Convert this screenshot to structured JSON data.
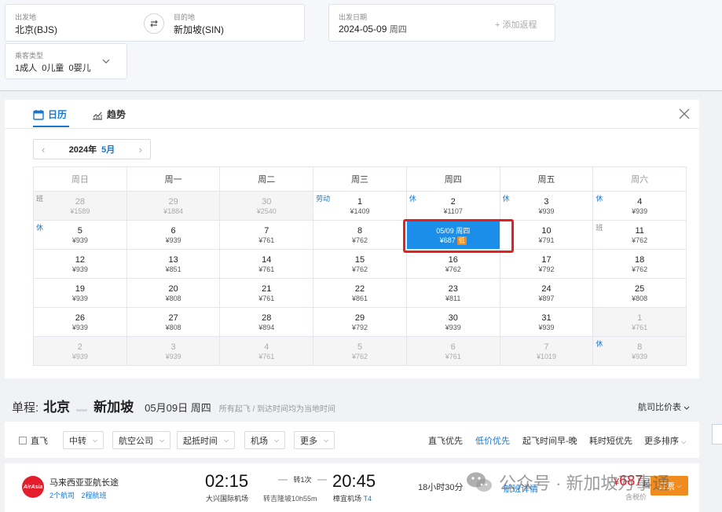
{
  "search": {
    "from": {
      "label": "出发地",
      "value": "北京(BJS)"
    },
    "to": {
      "label": "目的地",
      "value": "新加坡(SIN)"
    },
    "date": {
      "label": "出发日期",
      "value": "2024-05-09",
      "weekday": "周四"
    },
    "add_return": "+ 添加返程",
    "passengers": {
      "label": "乘客类型",
      "value": "1成人  0儿童  0婴儿"
    }
  },
  "calendar": {
    "tabs": [
      {
        "label": "日历"
      },
      {
        "label": "趋势"
      }
    ],
    "year": "2024年",
    "month": "5月",
    "weekdays": [
      "周日",
      "周一",
      "周二",
      "周三",
      "周四",
      "周五",
      "周六"
    ],
    "tag_labels": {
      "xiu": "休",
      "ban": "班",
      "laodong": "劳动"
    },
    "low_label": "低",
    "weeks": [
      [
        {
          "day": "28",
          "price": "¥1589",
          "other": true,
          "tag": "ban"
        },
        {
          "day": "29",
          "price": "¥1884",
          "other": true
        },
        {
          "day": "30",
          "price": "¥2540",
          "other": true
        },
        {
          "day": "1",
          "price": "¥1409",
          "tag": "laodong"
        },
        {
          "day": "2",
          "price": "¥1107",
          "tag": "xiu"
        },
        {
          "day": "3",
          "price": "¥939",
          "tag": "xiu"
        },
        {
          "day": "4",
          "price": "¥939",
          "tag": "xiu"
        }
      ],
      [
        {
          "day": "5",
          "price": "¥939",
          "tag": "xiu"
        },
        {
          "day": "6",
          "price": "¥939"
        },
        {
          "day": "7",
          "price": "¥761"
        },
        {
          "day": "8",
          "price": "¥762"
        },
        {
          "day": "05/09 周四",
          "price": "¥687",
          "selected": true,
          "low": true
        },
        {
          "day": "10",
          "price": "¥791"
        },
        {
          "day": "11",
          "price": "¥762",
          "tag": "ban"
        }
      ],
      [
        {
          "day": "12",
          "price": "¥939"
        },
        {
          "day": "13",
          "price": "¥851"
        },
        {
          "day": "14",
          "price": "¥761"
        },
        {
          "day": "15",
          "price": "¥762"
        },
        {
          "day": "16",
          "price": "¥762"
        },
        {
          "day": "17",
          "price": "¥792"
        },
        {
          "day": "18",
          "price": "¥762"
        }
      ],
      [
        {
          "day": "19",
          "price": "¥939"
        },
        {
          "day": "20",
          "price": "¥808"
        },
        {
          "day": "21",
          "price": "¥761"
        },
        {
          "day": "22",
          "price": "¥861"
        },
        {
          "day": "23",
          "price": "¥811"
        },
        {
          "day": "24",
          "price": "¥897"
        },
        {
          "day": "25",
          "price": "¥808"
        }
      ],
      [
        {
          "day": "26",
          "price": "¥939"
        },
        {
          "day": "27",
          "price": "¥808"
        },
        {
          "day": "28",
          "price": "¥894"
        },
        {
          "day": "29",
          "price": "¥792"
        },
        {
          "day": "30",
          "price": "¥939"
        },
        {
          "day": "31",
          "price": "¥939"
        },
        {
          "day": "1",
          "price": "¥761",
          "other": true
        }
      ],
      [
        {
          "day": "2",
          "price": "¥939",
          "other": true
        },
        {
          "day": "3",
          "price": "¥939",
          "other": true
        },
        {
          "day": "4",
          "price": "¥761",
          "other": true
        },
        {
          "day": "5",
          "price": "¥762",
          "other": true
        },
        {
          "day": "6",
          "price": "¥761",
          "other": true
        },
        {
          "day": "7",
          "price": "¥1019",
          "other": true
        },
        {
          "day": "8",
          "price": "¥939",
          "other": true,
          "tag": "xiu"
        }
      ]
    ]
  },
  "route": {
    "label": "单程:",
    "from": "北京",
    "to": "新加坡",
    "date": "05月09日 周四",
    "note": "所有起飞 / 到达时间均为当地时间",
    "price_table": "航司比价表"
  },
  "filters": {
    "direct": "直飞",
    "dropdowns": [
      "中转",
      "航空公司",
      "起抵时间",
      "机场",
      "更多"
    ],
    "sorts": [
      {
        "label": "直飞优先",
        "active": false
      },
      {
        "label": "低价优先",
        "active": true
      },
      {
        "label": "起飞时间早-晚",
        "active": false
      },
      {
        "label": "耗时短优先",
        "active": false
      },
      {
        "label": "更多排序",
        "active": false
      }
    ]
  },
  "flight": {
    "logo_text": "AirAsia",
    "airline": "马来西亚亚航长途",
    "sub": [
      "2个航司",
      "2程航班"
    ],
    "dep_time": "02:15",
    "dep_airport": "大兴国际机场",
    "stop": "转1次",
    "stop_note": "转吉隆坡10h55m",
    "arr_time": "20:45",
    "arr_airport": "樟宜机场",
    "arr_terminal": "T4",
    "duration": "18小时30分",
    "detail": "航班详情",
    "price": "687",
    "price_symbol": "¥",
    "price_suffix": "起",
    "tax_note": "含税价",
    "book": "订票"
  },
  "watermark": {
    "text": "公众号 · 新加坡万事通"
  }
}
